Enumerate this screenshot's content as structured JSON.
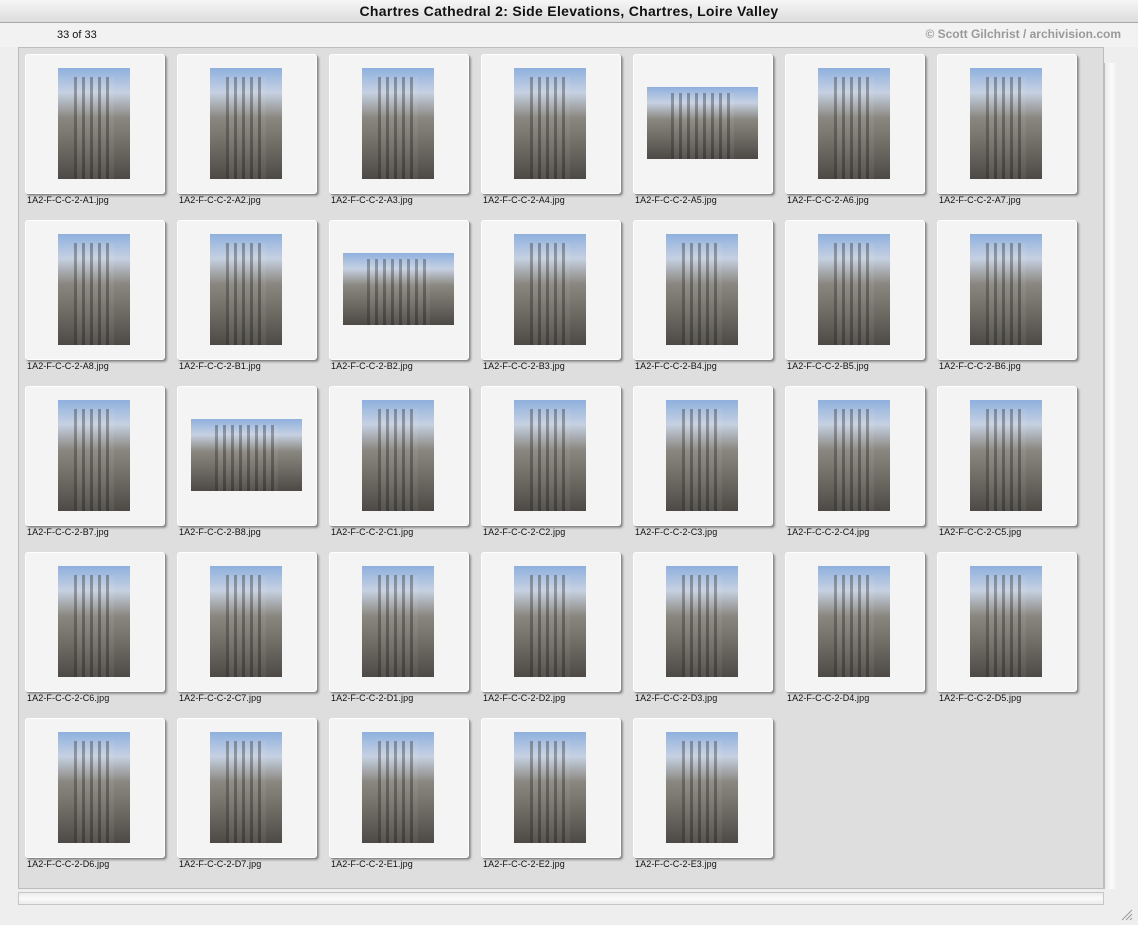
{
  "window": {
    "title": "Chartres Cathedral 2: Side Elevations, Chartres, Loire Valley"
  },
  "header": {
    "count": "33 of 33",
    "copyright": "© Scott Gilchrist / archivision.com"
  },
  "thumbnails": [
    {
      "file": "1A2-F-C-C-2-A1.jpg",
      "orientation": "portrait"
    },
    {
      "file": "1A2-F-C-C-2-A2.jpg",
      "orientation": "portrait"
    },
    {
      "file": "1A2-F-C-C-2-A3.jpg",
      "orientation": "portrait"
    },
    {
      "file": "1A2-F-C-C-2-A4.jpg",
      "orientation": "portrait"
    },
    {
      "file": "1A2-F-C-C-2-A5.jpg",
      "orientation": "landscape"
    },
    {
      "file": "1A2-F-C-C-2-A6.jpg",
      "orientation": "portrait"
    },
    {
      "file": "1A2-F-C-C-2-A7.jpg",
      "orientation": "portrait"
    },
    {
      "file": "1A2-F-C-C-2-A8.jpg",
      "orientation": "portrait"
    },
    {
      "file": "1A2-F-C-C-2-B1.jpg",
      "orientation": "portrait"
    },
    {
      "file": "1A2-F-C-C-2-B2.jpg",
      "orientation": "landscape"
    },
    {
      "file": "1A2-F-C-C-2-B3.jpg",
      "orientation": "portrait"
    },
    {
      "file": "1A2-F-C-C-2-B4.jpg",
      "orientation": "portrait"
    },
    {
      "file": "1A2-F-C-C-2-B5.jpg",
      "orientation": "portrait"
    },
    {
      "file": "1A2-F-C-C-2-B6.jpg",
      "orientation": "portrait"
    },
    {
      "file": "1A2-F-C-C-2-B7.jpg",
      "orientation": "portrait"
    },
    {
      "file": "1A2-F-C-C-2-B8.jpg",
      "orientation": "landscape"
    },
    {
      "file": "1A2-F-C-C-2-C1.jpg",
      "orientation": "portrait"
    },
    {
      "file": "1A2-F-C-C-2-C2.jpg",
      "orientation": "portrait"
    },
    {
      "file": "1A2-F-C-C-2-C3.jpg",
      "orientation": "portrait"
    },
    {
      "file": "1A2-F-C-C-2-C4.jpg",
      "orientation": "portrait"
    },
    {
      "file": "1A2-F-C-C-2-C5.jpg",
      "orientation": "portrait"
    },
    {
      "file": "1A2-F-C-C-2-C6.jpg",
      "orientation": "portrait"
    },
    {
      "file": "1A2-F-C-C-2-C7.jpg",
      "orientation": "portrait"
    },
    {
      "file": "1A2-F-C-C-2-D1.jpg",
      "orientation": "portrait"
    },
    {
      "file": "1A2-F-C-C-2-D2.jpg",
      "orientation": "portrait"
    },
    {
      "file": "1A2-F-C-C-2-D3.jpg",
      "orientation": "portrait"
    },
    {
      "file": "1A2-F-C-C-2-D4.jpg",
      "orientation": "portrait"
    },
    {
      "file": "1A2-F-C-C-2-D5.jpg",
      "orientation": "portrait"
    },
    {
      "file": "1A2-F-C-C-2-D6.jpg",
      "orientation": "portrait"
    },
    {
      "file": "1A2-F-C-C-2-D7.jpg",
      "orientation": "portrait"
    },
    {
      "file": "1A2-F-C-C-2-E1.jpg",
      "orientation": "portrait"
    },
    {
      "file": "1A2-F-C-C-2-E2.jpg",
      "orientation": "portrait"
    },
    {
      "file": "1A2-F-C-C-2-E3.jpg",
      "orientation": "portrait"
    }
  ]
}
